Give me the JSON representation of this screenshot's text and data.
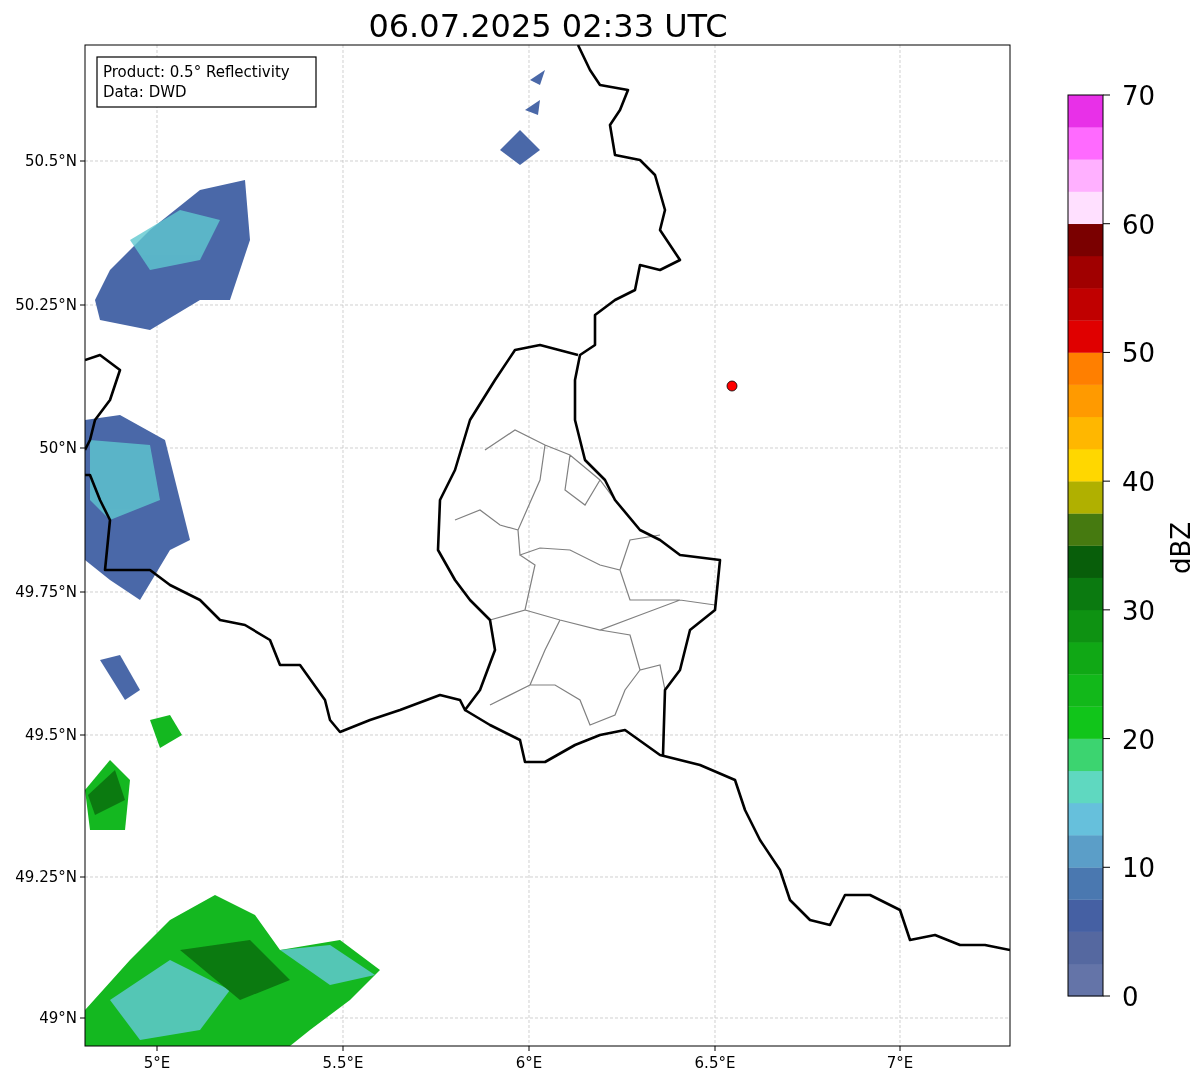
{
  "title": "06.07.2025 02:33 UTC",
  "info_box": [
    "Product: 0.5° Reflectivity",
    "Data: DWD"
  ],
  "y_axis": {
    "ticks": [
      "50.5°N",
      "50.25°N",
      "50°N",
      "49.75°N",
      "49.5°N",
      "49.25°N",
      "49°N"
    ]
  },
  "x_axis": {
    "ticks": [
      "5°E",
      "5.5°E",
      "6°E",
      "6.5°E",
      "7°E"
    ]
  },
  "colorbar": {
    "label": "dBZ",
    "ticks": [
      "70",
      "60",
      "50",
      "40",
      "30",
      "20",
      "10",
      "0"
    ],
    "bins": [
      {
        "color": "#6474a8"
      },
      {
        "color": "#5568a0"
      },
      {
        "color": "#4560a3"
      },
      {
        "color": "#4a78b0"
      },
      {
        "color": "#5b9ec8"
      },
      {
        "color": "#66c0dc"
      },
      {
        "color": "#5fd8c0"
      },
      {
        "color": "#3cd470"
      },
      {
        "color": "#11c51a"
      },
      {
        "color": "#12b81a"
      },
      {
        "color": "#10a815"
      },
      {
        "color": "#0e9212"
      },
      {
        "color": "#0b7a10"
      },
      {
        "color": "#085e0a"
      },
      {
        "color": "#467a10"
      },
      {
        "color": "#b0b000"
      },
      {
        "color": "#ffd700"
      },
      {
        "color": "#ffb700"
      },
      {
        "color": "#ff9a00"
      },
      {
        "color": "#ff7f00"
      },
      {
        "color": "#e00000"
      },
      {
        "color": "#c00000"
      },
      {
        "color": "#a00000"
      },
      {
        "color": "#7a0000"
      },
      {
        "color": "#ffe0ff"
      },
      {
        "color": "#ffb0ff"
      },
      {
        "color": "#ff6aff"
      },
      {
        "color": "#e830e8"
      }
    ]
  }
}
